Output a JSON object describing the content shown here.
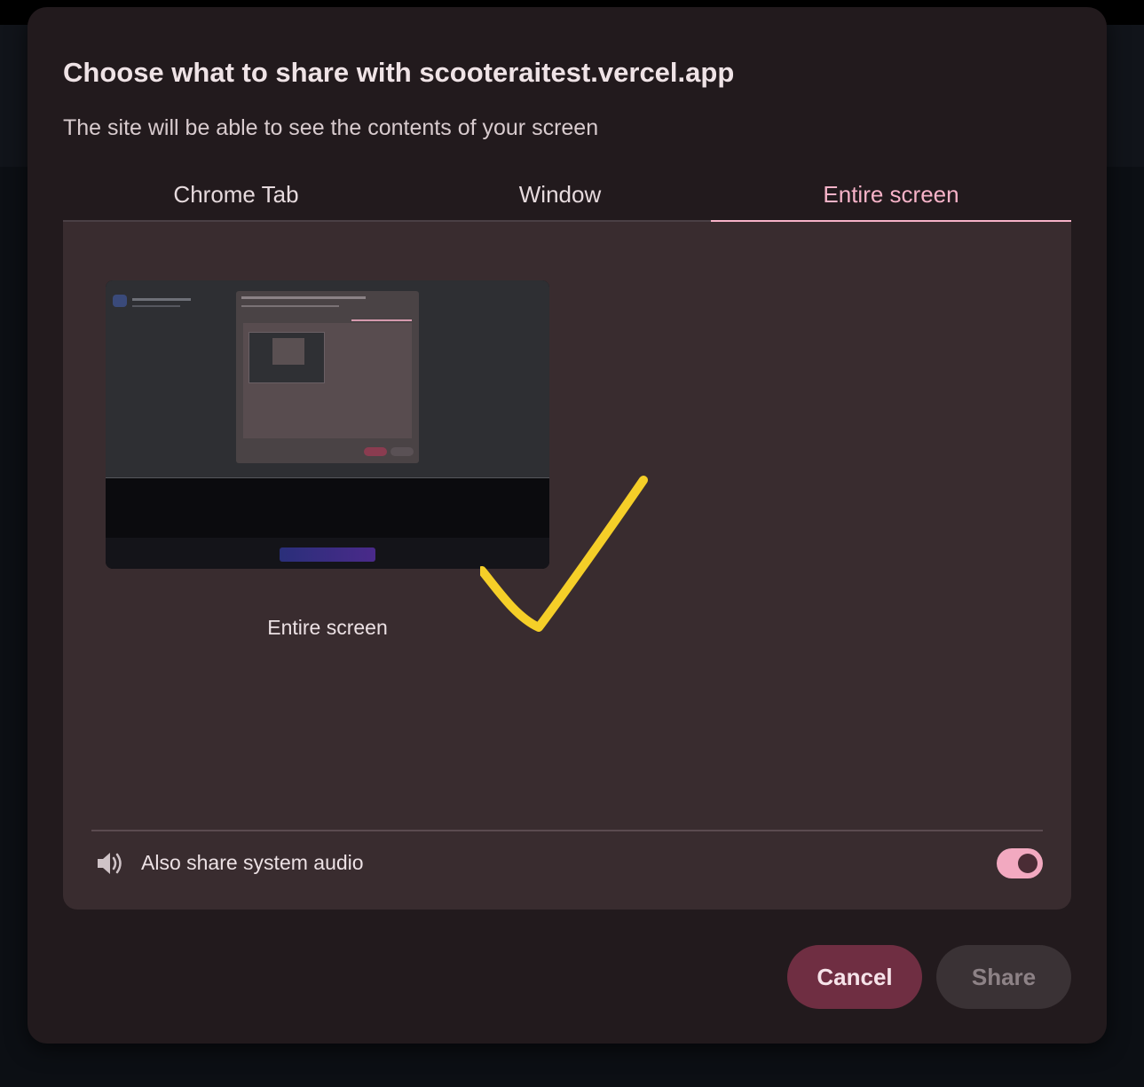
{
  "dialog": {
    "title": "Choose what to share with scooteraitest.vercel.app",
    "subtitle": "The site will be able to see the contents of your screen"
  },
  "tabs": [
    {
      "label": "Chrome Tab",
      "selected": false
    },
    {
      "label": "Window",
      "selected": false
    },
    {
      "label": "Entire screen",
      "selected": true
    }
  ],
  "source": {
    "label": "Entire screen",
    "thumbnail_icon": "screen-preview-thumbnail"
  },
  "annotation": {
    "icon": "yellow-checkmark-icon",
    "color": "#f5cf28"
  },
  "audio": {
    "label": "Also share system audio",
    "icon": "speaker-icon",
    "enabled": true
  },
  "buttons": {
    "cancel": "Cancel",
    "share": "Share"
  },
  "colors": {
    "accent": "#f7b3c8",
    "cancel_bg": "#6f2e42",
    "dialog_bg": "#221a1d",
    "panel_bg": "#392c2f"
  }
}
